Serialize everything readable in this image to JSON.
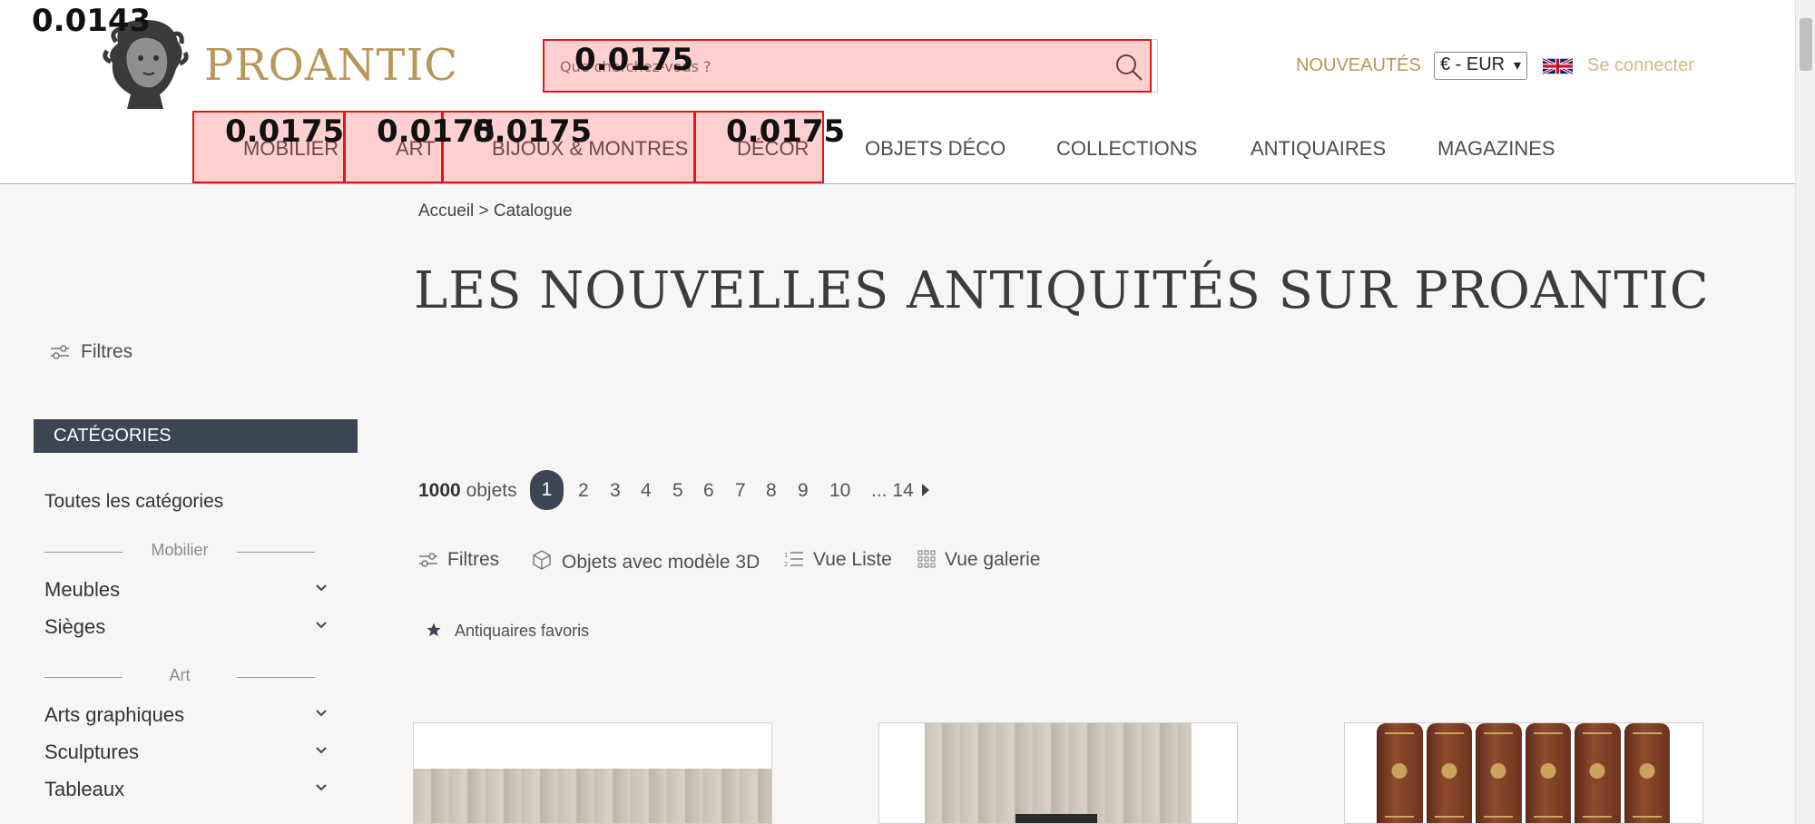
{
  "brand": {
    "name": "PROANTIC",
    "gold": "#b8975a",
    "dark": "#3b4554",
    "annotation_red": "#e01818"
  },
  "header": {
    "search_placeholder": "Que cherchez-vous ?",
    "nouveautes": "NOUVEAUTÉS",
    "currency": "€ - EUR",
    "flag": "uk-flag-icon",
    "login": "Se connecter"
  },
  "nav": [
    "MOBILIER",
    "ART",
    "BIJOUX & MONTRES",
    "DÉCOR",
    "OBJETS DÉCO",
    "COLLECTIONS",
    "ANTIQUAIRES",
    "MAGAZINES"
  ],
  "annotations": {
    "logo": "0.0143",
    "search": "0.0175",
    "mobilier": "0.0175",
    "art": "0.0175",
    "bijoux": "0.0175",
    "decor": "0.0175"
  },
  "breadcrumb": "Accueil > Catalogue",
  "page_title": "LES NOUVELLES ANTIQUITÉS SUR PROANTIC",
  "sidebar": {
    "filters": "Filtres",
    "categories_header": "CATÉGORIES",
    "all_categories": "Toutes les catégories",
    "groups": [
      {
        "label": "Mobilier",
        "items": [
          "Meubles",
          "Sièges"
        ]
      },
      {
        "label": "Art",
        "items": [
          "Arts graphiques",
          "Sculptures",
          "Tableaux"
        ]
      }
    ]
  },
  "listing": {
    "count": "1000",
    "count_unit": "objets",
    "pages": [
      "2",
      "3",
      "4",
      "5",
      "6",
      "7",
      "8",
      "9",
      "10"
    ],
    "active_page": "1",
    "last_page": "... 14",
    "tools": {
      "filters": "Filtres",
      "model3d": "Objets avec modèle 3D",
      "list_view": "Vue Liste",
      "gallery_view": "Vue galerie"
    },
    "favorites": "Antiquaires favoris"
  }
}
